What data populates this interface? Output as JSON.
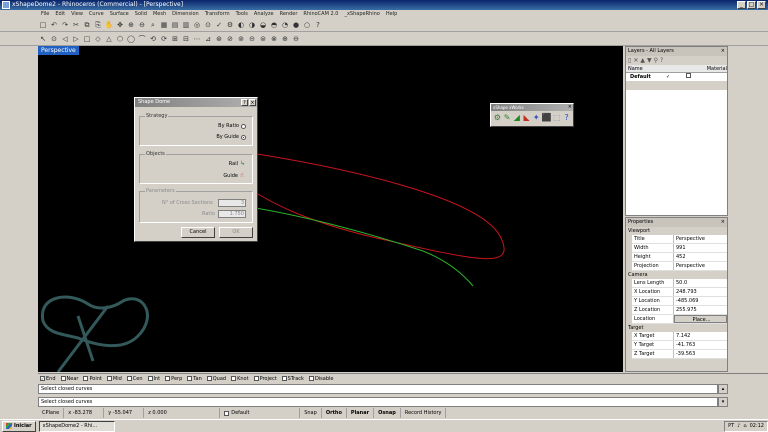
{
  "window": {
    "title": "xShapeDome2 - Rhinoceros (Commercial) - [Perspective]",
    "controls": [
      "_",
      "□",
      "×"
    ]
  },
  "menus": [
    "File",
    "Edit",
    "View",
    "Curve",
    "Surface",
    "Solid",
    "Mesh",
    "Dimension",
    "Transform",
    "Tools",
    "Analyze",
    "Render",
    "RhinoCAM 2.0",
    "_xShapeRhino",
    "Help"
  ],
  "toolbar_icons": {
    "row1": [
      "□",
      "↶",
      "↷",
      "✂",
      "⧉",
      "⎘",
      "✋",
      "✥",
      "⊕",
      "⊖",
      "⌕",
      "▦",
      "▤",
      "▥",
      "◎",
      "⊙",
      "✓",
      "⚙",
      "◐",
      "◑",
      "◒",
      "◓",
      "◔",
      "●",
      "○",
      "?"
    ],
    "row2": [
      "↖",
      "⊙",
      "◁",
      "▷",
      "□",
      "◇",
      "△",
      "⬡",
      "◯",
      "⌒",
      "⟲",
      "⟳",
      "⊞",
      "⊟",
      "⋯",
      "⊿",
      "⊛",
      "⊘",
      "⊚",
      "⊝",
      "⊜",
      "⊗",
      "⊕",
      "⊖"
    ]
  },
  "viewport": {
    "label": "Perspective"
  },
  "dialog": {
    "title": "Shape Dome",
    "help": "?",
    "close": "×",
    "strategy": {
      "label": "Strategy",
      "by_ratio": "By Ratio",
      "by_guide": "By Guide"
    },
    "objects": {
      "label": "Objects",
      "rail": "Rail",
      "guide": "Guide"
    },
    "parameters": {
      "label": "Parameters",
      "cross_sections": "N° of Cross Sections",
      "cross_sections_value": "3",
      "ratio": "Ratio",
      "ratio_value": "1.750"
    },
    "cancel": "Cancel",
    "ok": "OK"
  },
  "floating_toolbar": {
    "title": "xShape xWorks",
    "close": "×",
    "icons": [
      "⚙",
      "✎",
      "◢",
      "◣",
      "✦",
      "⬛",
      "⬚",
      "?"
    ]
  },
  "layers": {
    "title": "Layers - All Layers",
    "columns": [
      "Name",
      "Material"
    ],
    "rows": [
      {
        "name": "Default",
        "current": "✓"
      }
    ]
  },
  "properties": {
    "title": "Properties",
    "viewport_section": "Viewport",
    "viewport_rows": [
      {
        "k": "Title",
        "v": "Perspective"
      },
      {
        "k": "Width",
        "v": "991"
      },
      {
        "k": "Height",
        "v": "452"
      },
      {
        "k": "Projection",
        "v": "Perspective"
      }
    ],
    "camera_section": "Camera",
    "camera_rows": [
      {
        "k": "Lens Length",
        "v": "50.0"
      },
      {
        "k": "X Location",
        "v": "248.793"
      },
      {
        "k": "Y Location",
        "v": "-485.069"
      },
      {
        "k": "Z Location",
        "v": "255.975"
      }
    ],
    "location_label": "Location",
    "place_btn": "Place...",
    "target_section": "Target",
    "target_rows": [
      {
        "k": "X Target",
        "v": "7.142"
      },
      {
        "k": "Y Target",
        "v": "-41.763"
      },
      {
        "k": "Z Target",
        "v": "-39.563"
      }
    ]
  },
  "osnap": [
    {
      "label": "End",
      "checked": true
    },
    {
      "label": "Near",
      "checked": false
    },
    {
      "label": "Point",
      "checked": false
    },
    {
      "label": "Mid",
      "checked": false
    },
    {
      "label": "Cen",
      "checked": false
    },
    {
      "label": "Int",
      "checked": false
    },
    {
      "label": "Perp",
      "checked": false
    },
    {
      "label": "Tan",
      "checked": false
    },
    {
      "label": "Quad",
      "checked": false
    },
    {
      "label": "Knot",
      "checked": false
    },
    {
      "label": "Project",
      "checked": false
    },
    {
      "label": "STrack",
      "checked": false
    },
    {
      "label": "Disable",
      "checked": false
    }
  ],
  "command": {
    "history": "Select closed curves",
    "prompt": "Select closed curves"
  },
  "status": {
    "cplane": "CPlane",
    "x": "x -83.278",
    "y": "y -55.047",
    "z": "z 0.000",
    "layer": "Default",
    "snap": "Snap",
    "ortho": "Ortho",
    "planar": "Planar",
    "osnap": "Osnap",
    "record": "Record History"
  },
  "taskbar": {
    "start": "Iniciar",
    "task": "xShapeDome2 - Rhi...",
    "lang": "PT",
    "time": "02:12"
  },
  "colors": {
    "rail_curve": "#c8141e",
    "guide_curve": "#2bb52b",
    "viewport_bg": "#000000",
    "watermark": "#5fa3a6"
  }
}
